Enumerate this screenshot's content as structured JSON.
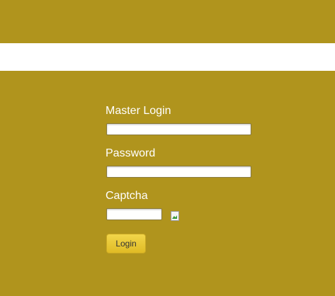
{
  "form": {
    "master_login_label": "Master Login",
    "master_login_value": "",
    "password_label": "Password",
    "password_value": "",
    "captcha_label": "Captcha",
    "captcha_value": "",
    "login_button_label": "Login"
  },
  "colors": {
    "background": "#b0941d",
    "band": "#ffffff",
    "button": "#e8c733"
  }
}
